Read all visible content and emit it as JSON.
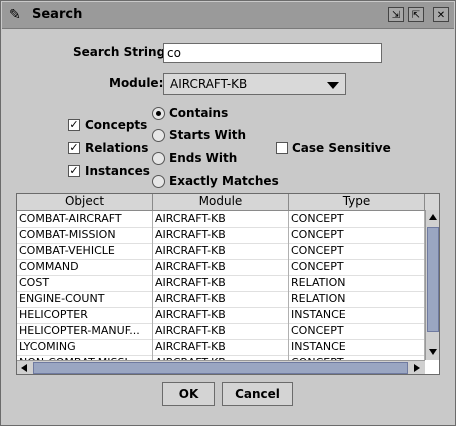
{
  "window": {
    "title": "Search"
  },
  "search": {
    "label": "Search String:",
    "value": "co"
  },
  "module": {
    "label": "Module:",
    "selected": "AIRCRAFT-KB"
  },
  "checkboxes": [
    {
      "label": "Concepts",
      "checked": true
    },
    {
      "label": "Relations",
      "checked": true
    },
    {
      "label": "Instances",
      "checked": true
    }
  ],
  "match_options": [
    {
      "label": "Contains",
      "selected": true
    },
    {
      "label": "Starts With",
      "selected": false
    },
    {
      "label": "Ends With",
      "selected": false
    },
    {
      "label": "Exactly Matches",
      "selected": false
    }
  ],
  "case_sensitive": {
    "label": "Case Sensitive",
    "checked": false
  },
  "table": {
    "headers": [
      "Object",
      "Module",
      "Type"
    ],
    "rows": [
      [
        "COMBAT-AIRCRAFT",
        "AIRCRAFT-KB",
        "CONCEPT"
      ],
      [
        "COMBAT-MISSION",
        "AIRCRAFT-KB",
        "CONCEPT"
      ],
      [
        "COMBAT-VEHICLE",
        "AIRCRAFT-KB",
        "CONCEPT"
      ],
      [
        "COMMAND",
        "AIRCRAFT-KB",
        "CONCEPT"
      ],
      [
        "COST",
        "AIRCRAFT-KB",
        "RELATION"
      ],
      [
        "ENGINE-COUNT",
        "AIRCRAFT-KB",
        "RELATION"
      ],
      [
        "HELICOPTER",
        "AIRCRAFT-KB",
        "INSTANCE"
      ],
      [
        "HELICOPTER-MANUF...",
        "AIRCRAFT-KB",
        "CONCEPT"
      ],
      [
        "LYCOMING",
        "AIRCRAFT-KB",
        "INSTANCE"
      ],
      [
        "NON-COMBAT-MISSI...",
        "AIRCRAFT-KB",
        "CONCEPT"
      ]
    ]
  },
  "buttons": {
    "ok": "OK",
    "cancel": "Cancel"
  }
}
